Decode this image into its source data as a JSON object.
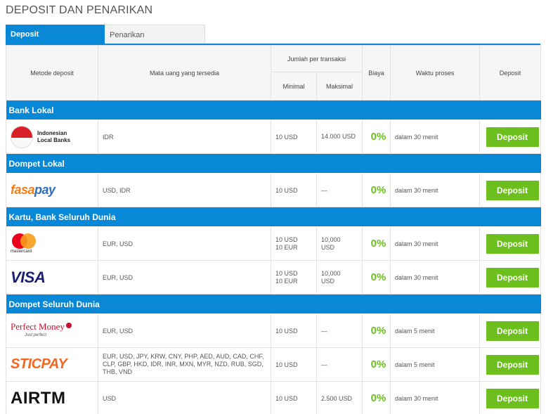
{
  "page_title": "DEPOSIT DAN PENARIKAN",
  "tabs": [
    {
      "label": "Deposit",
      "active": true
    },
    {
      "label": "Penarikan",
      "active": false
    }
  ],
  "headers": {
    "method": "Metode deposit",
    "currency": "Mata uang yang tersedia",
    "per_tx": "Jumlah per transaksi",
    "min": "Minimal",
    "max": "Maksimal",
    "fee": "Biaya",
    "time": "Waktu proses",
    "deposit": "Deposit"
  },
  "categories": {
    "bank_local": "Bank Lokal",
    "wallet_local": "Dompet Lokal",
    "card_world": "Kartu, Bank Seluruh Dunia",
    "wallet_world": "Dompet Seluruh Dunia"
  },
  "logos": {
    "indonesian_line1": "Indonesian",
    "indonesian_line2": "Local Banks",
    "fasapay_a": "fasa",
    "fasapay_b": "pay",
    "mastercard": "mastercard",
    "visa": "VISA",
    "perfect_money": "Perfect Money",
    "perfect_money_sub": "Just perfect",
    "sticpay": "STICPAY",
    "airtm": "AIRTM"
  },
  "rows": [
    {
      "method": "Indonesian Local Banks",
      "currency": "IDR",
      "min": "10 USD",
      "max": "14.000 USD",
      "fee": "0%",
      "time": "dalam 30 menit",
      "button": "Deposit"
    },
    {
      "method": "FasaPay",
      "currency": "USD, IDR",
      "min": "10 USD",
      "max": "—",
      "fee": "0%",
      "time": "dalam 30 menit",
      "button": "Deposit"
    },
    {
      "method": "Mastercard",
      "currency": "EUR, USD",
      "min": "10 USD",
      "min2": "10 EUR",
      "max": "10,000",
      "max2": "USD",
      "fee": "0%",
      "time": "dalam 30 menit",
      "button": "Deposit"
    },
    {
      "method": "Visa",
      "currency": "EUR, USD",
      "min": "10 USD",
      "min2": "10 EUR",
      "max": "10,000",
      "max2": "USD",
      "fee": "0%",
      "time": "dalam 30 menit",
      "button": "Deposit"
    },
    {
      "method": "Perfect Money",
      "currency": "EUR, USD",
      "min": "10 USD",
      "max": "—",
      "fee": "0%",
      "time": "dalam 5 menit",
      "button": "Deposit"
    },
    {
      "method": "STICPAY",
      "currency": "EUR, USD, JPY, KRW, CNY, PHP, AED, AUD, CAD, CHF, CLP, GBP, HKD, IDR, INR, MXN, MYR, NZD, RUB, SGD, THB, VND",
      "min": "10 USD",
      "max": "—",
      "fee": "0%",
      "time": "dalam 5 menit",
      "button": "Deposit"
    },
    {
      "method": "AIRTM",
      "currency": "USD",
      "min": "10 USD",
      "max": "2.500 USD",
      "fee": "0%",
      "time": "dalam 30 menit",
      "button": "Deposit"
    }
  ],
  "colors": {
    "accent": "#0a88d8",
    "fee_green": "#6ac11a",
    "button_green": "#6cbf1c"
  }
}
